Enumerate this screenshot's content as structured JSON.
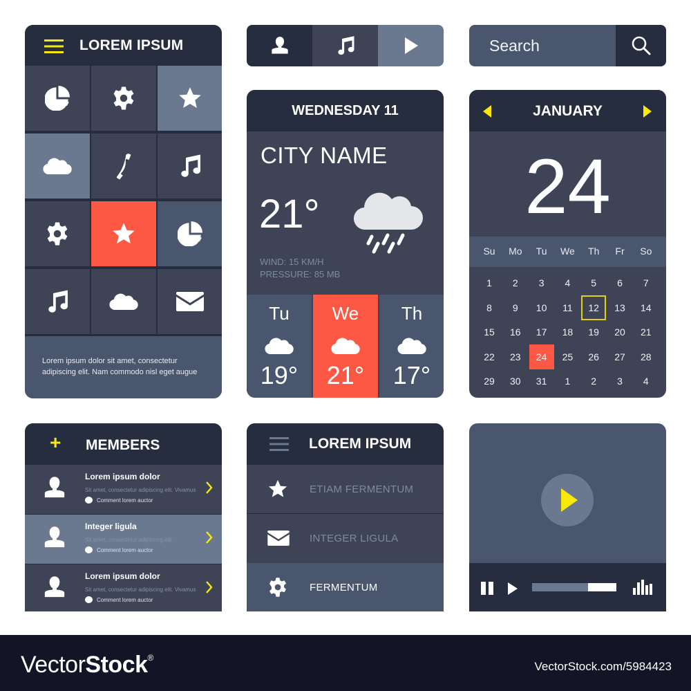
{
  "colors": {
    "dark": "#252d3f",
    "mid": "#3e4455",
    "slate": "#4a566e",
    "light": "#6a7890",
    "coral": "#fd5844",
    "yellow": "#f9e90a"
  },
  "grid_menu": {
    "menu_icon": "hamburger-icon",
    "title": "LOREM IPSUM",
    "tiles": [
      {
        "icon": "pie-chart-icon",
        "style": "mid"
      },
      {
        "icon": "gear-icon",
        "style": "mid"
      },
      {
        "icon": "star-icon",
        "style": "light"
      },
      {
        "icon": "cloud-icon",
        "style": "light"
      },
      {
        "icon": "phone-icon",
        "style": "mid"
      },
      {
        "icon": "music-note-icon",
        "style": "mid"
      },
      {
        "icon": "gear-icon",
        "style": "mid"
      },
      {
        "icon": "star-icon",
        "style": "coral"
      },
      {
        "icon": "pie-chart-icon",
        "style": "slate"
      },
      {
        "icon": "music-note-icon",
        "style": "mid"
      },
      {
        "icon": "cloud-icon",
        "style": "mid"
      },
      {
        "icon": "envelope-icon",
        "style": "mid"
      }
    ],
    "footer_text": "Lorem ipsum dolor sit amet, consectetur adipiscing elit. Nam commodo nisl eget augue"
  },
  "tab_bar": {
    "tabs": [
      {
        "icon": "user-icon",
        "active": true
      },
      {
        "icon": "music-note-icon",
        "active": false
      },
      {
        "icon": "play-icon",
        "active": false
      }
    ]
  },
  "search": {
    "placeholder": "Search",
    "button_icon": "search-icon"
  },
  "weather": {
    "date_header": "WEDNESDAY 11",
    "city": "CITY NAME",
    "temperature": "21°",
    "condition_icon": "rain-cloud-icon",
    "wind": "WIND: 15 KM/H",
    "pressure": "PRESSURE: 85 MB",
    "forecast": [
      {
        "day": "Tu",
        "icon": "cloud-icon",
        "temp": "19°",
        "active": false
      },
      {
        "day": "We",
        "icon": "cloud-icon",
        "temp": "21°",
        "active": true
      },
      {
        "day": "Th",
        "icon": "cloud-icon",
        "temp": "17°",
        "active": false
      }
    ]
  },
  "calendar": {
    "month": "JANUARY",
    "prev_icon": "triangle-left-icon",
    "next_icon": "triangle-right-icon",
    "big_day": "24",
    "weekdays": [
      "Su",
      "Mo",
      "Tu",
      "We",
      "Th",
      "Fr",
      "So"
    ],
    "weeks": [
      [
        "1",
        "2",
        "3",
        "4",
        "5",
        "6",
        "7"
      ],
      [
        "8",
        "9",
        "10",
        "11",
        "12",
        "13",
        "14"
      ],
      [
        "15",
        "16",
        "17",
        "18",
        "19",
        "20",
        "21"
      ],
      [
        "22",
        "23",
        "24",
        "25",
        "26",
        "27",
        "28"
      ],
      [
        "29",
        "30",
        "31",
        "1",
        "2",
        "3",
        "4"
      ]
    ],
    "today": "24",
    "highlighted": "12"
  },
  "members": {
    "add_icon": "plus-icon",
    "add_label": "+",
    "title": "MEMBERS",
    "rows": [
      {
        "name": "Lorem ipsum dolor",
        "desc": "Sit amet, consectetur adipiscing elit. Vivamus",
        "comment": "Comment lorem auctor",
        "style": "mid"
      },
      {
        "name": "Integer ligula",
        "desc": "Sit amet, consectetur adipiscing elit.",
        "comment": "Comment lorem auctor",
        "style": "light"
      },
      {
        "name": "Lorem ipsum dolor",
        "desc": "Sit amet, consectetur adipiscing elit. Vivamus",
        "comment": "Comment lorem auctor",
        "style": "mid"
      }
    ]
  },
  "list_menu": {
    "menu_icon": "hamburger-icon",
    "title": "LOREM IPSUM",
    "items": [
      {
        "icon": "star-icon",
        "label": "ETIAM FERMENTUM",
        "active": false
      },
      {
        "icon": "envelope-icon",
        "label": "INTEGER LIGULA",
        "active": false
      },
      {
        "icon": "gear-icon",
        "label": "FERMENTUM",
        "active": true
      }
    ]
  },
  "player": {
    "big_play_icon": "play-icon",
    "pause_icon": "pause-icon",
    "play_icon": "play-icon",
    "equalizer_icon": "equalizer-icon",
    "progress": 0.66
  },
  "footer": {
    "logo_light": "Vector",
    "logo_bold": "Stock",
    "logo_mark": "®",
    "reference": "VectorStock.com/5984423"
  }
}
